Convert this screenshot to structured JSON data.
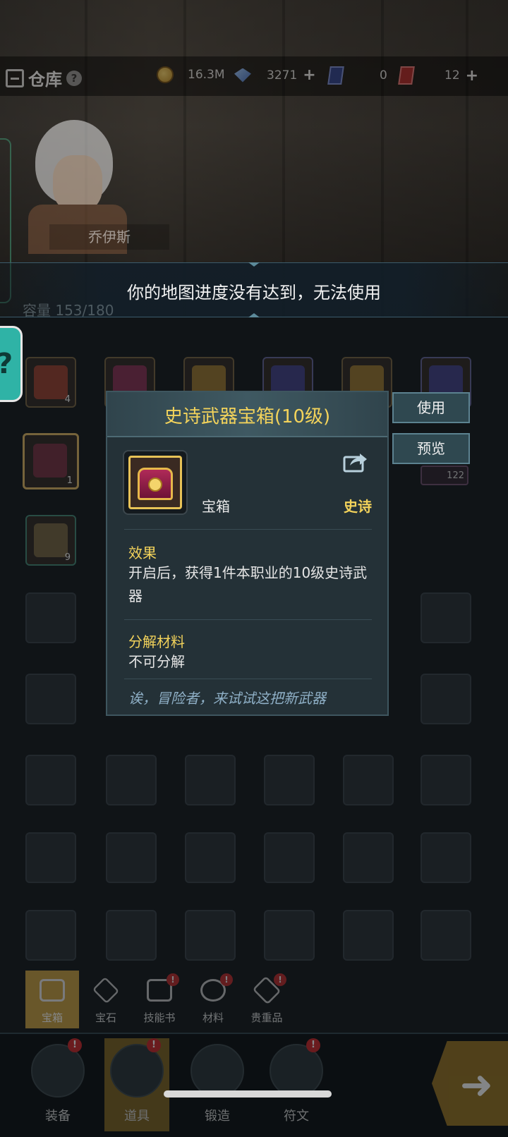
{
  "header": {
    "title": "仓库",
    "help_icon": "question-mark",
    "resources": [
      {
        "icon": "gold-coin-icon",
        "value": "16.3M"
      },
      {
        "icon": "blue-gem-icon",
        "value": "3271",
        "plus": "+"
      },
      {
        "icon": "blue-card-icon",
        "value": "0"
      },
      {
        "icon": "red-card-icon",
        "value": "12",
        "plus": "+"
      }
    ]
  },
  "hero": {
    "name": "乔伊斯"
  },
  "notice": {
    "message": "你的地图进度没有达到，无法使用"
  },
  "inventory": {
    "capacity_text": "容量 153/180",
    "slots": [
      {
        "count": "4"
      },
      {
        "count": ""
      },
      {
        "count": ""
      },
      {
        "count": ""
      },
      {
        "count": ""
      },
      {
        "count": ""
      },
      {
        "count": "1"
      },
      {
        "count": "122"
      },
      {
        "count": "9"
      }
    ]
  },
  "item_detail": {
    "title": "史诗武器宝箱(10级)",
    "type": "宝箱",
    "rarity": "史诗",
    "effect_title": "效果",
    "effect_text": "开启后，获得1件本职业的10级史诗武器",
    "salvage_title": "分解材料",
    "salvage_text": "不可分解",
    "flavor": "诶，冒险者，来试试这把新武器",
    "accent_color": "#f3d35b"
  },
  "actions": {
    "use_label": "使用",
    "preview_label": "预览"
  },
  "categories": [
    {
      "label": "宝箱",
      "active": true
    },
    {
      "label": "宝石"
    },
    {
      "label": "技能书",
      "badge": "!"
    },
    {
      "label": "材料",
      "badge": "!"
    },
    {
      "label": "贵重品",
      "badge": "!"
    }
  ],
  "bottom_nav": [
    {
      "label": "装备",
      "badge": "!"
    },
    {
      "label": "道具",
      "badge": "!",
      "active": true
    },
    {
      "label": "锻造"
    },
    {
      "label": "符文",
      "badge": "!"
    }
  ]
}
